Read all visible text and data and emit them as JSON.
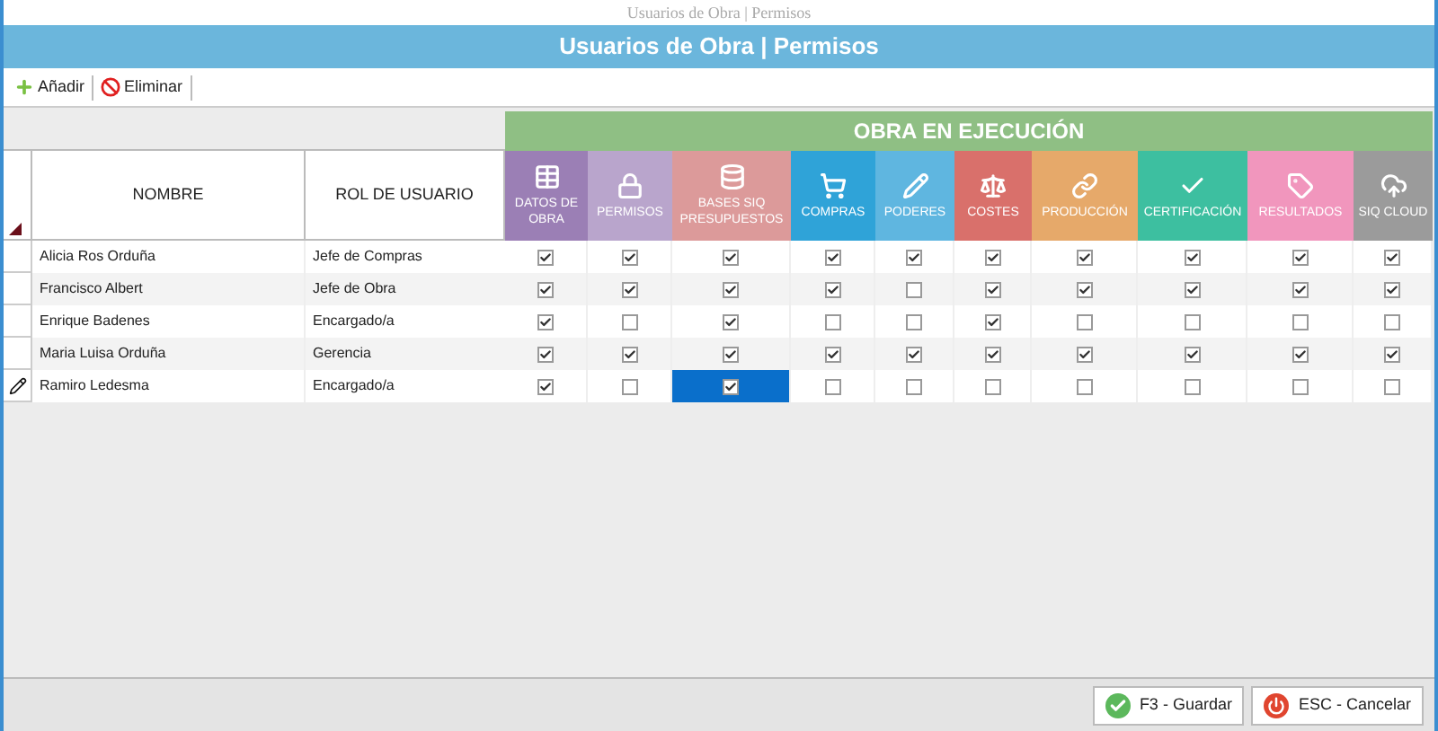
{
  "window": {
    "title": "Usuarios de Obra | Permisos"
  },
  "header": {
    "title": "Usuarios de Obra | Permisos"
  },
  "toolbar": [
    {
      "label": "Añadir",
      "kind": "add"
    },
    {
      "label": "Eliminar",
      "kind": "delete"
    }
  ],
  "table": {
    "group_header": "OBRA EN EJECUCIÓN",
    "name_column": "NOMBRE",
    "role_column": "ROL DE USUARIO",
    "columns": [
      {
        "label": "DATOS DE OBRA",
        "kind": "grid",
        "color": "#9b7fb5"
      },
      {
        "label": "PERMISOS",
        "kind": "lock",
        "color": "#b9a5cc"
      },
      {
        "label": "BASES SIQ PRESUPUESTOS",
        "kind": "database",
        "color": "#dc9a9a"
      },
      {
        "label": "COMPRAS",
        "kind": "cart",
        "color": "#2fa3d8"
      },
      {
        "label": "PODERES",
        "kind": "pencil",
        "color": "#5fb6e0"
      },
      {
        "label": "COSTES",
        "kind": "scale",
        "color": "#d9706b"
      },
      {
        "label": "PRODUCCIÓN",
        "kind": "link",
        "color": "#e6a96a"
      },
      {
        "label": "CERTIFICACIÓN",
        "kind": "check",
        "color": "#3dbfa0"
      },
      {
        "label": "RESULTADOS",
        "kind": "tag",
        "color": "#f196bd"
      },
      {
        "label": "SIQ CLOUD",
        "kind": "cloud",
        "color": "#9b9b9b"
      }
    ],
    "rows": [
      {
        "name": "Alicia Ros Orduña",
        "role": "Jefe de Compras",
        "editing": false,
        "permissions": [
          {
            "checked": true,
            "selected": false
          },
          {
            "checked": true,
            "selected": false
          },
          {
            "checked": true,
            "selected": false
          },
          {
            "checked": true,
            "selected": false
          },
          {
            "checked": true,
            "selected": false
          },
          {
            "checked": true,
            "selected": false
          },
          {
            "checked": true,
            "selected": false
          },
          {
            "checked": true,
            "selected": false
          },
          {
            "checked": true,
            "selected": false
          },
          {
            "checked": true,
            "selected": false
          }
        ]
      },
      {
        "name": "Francisco Albert",
        "role": "Jefe de Obra",
        "editing": false,
        "permissions": [
          {
            "checked": true,
            "selected": false
          },
          {
            "checked": true,
            "selected": false
          },
          {
            "checked": true,
            "selected": false
          },
          {
            "checked": true,
            "selected": false
          },
          {
            "checked": false,
            "selected": false
          },
          {
            "checked": true,
            "selected": false
          },
          {
            "checked": true,
            "selected": false
          },
          {
            "checked": true,
            "selected": false
          },
          {
            "checked": true,
            "selected": false
          },
          {
            "checked": true,
            "selected": false
          }
        ]
      },
      {
        "name": "Enrique Badenes",
        "role": "Encargado/a",
        "editing": false,
        "permissions": [
          {
            "checked": true,
            "selected": false
          },
          {
            "checked": false,
            "selected": false
          },
          {
            "checked": true,
            "selected": false
          },
          {
            "checked": false,
            "selected": false
          },
          {
            "checked": false,
            "selected": false
          },
          {
            "checked": true,
            "selected": false
          },
          {
            "checked": false,
            "selected": false
          },
          {
            "checked": false,
            "selected": false
          },
          {
            "checked": false,
            "selected": false
          },
          {
            "checked": false,
            "selected": false
          }
        ]
      },
      {
        "name": "Maria Luisa Orduña",
        "role": "Gerencia",
        "editing": false,
        "permissions": [
          {
            "checked": true,
            "selected": false
          },
          {
            "checked": true,
            "selected": false
          },
          {
            "checked": true,
            "selected": false
          },
          {
            "checked": true,
            "selected": false
          },
          {
            "checked": true,
            "selected": false
          },
          {
            "checked": true,
            "selected": false
          },
          {
            "checked": true,
            "selected": false
          },
          {
            "checked": true,
            "selected": false
          },
          {
            "checked": true,
            "selected": false
          },
          {
            "checked": true,
            "selected": false
          }
        ]
      },
      {
        "name": "Ramiro Ledesma",
        "role": "Encargado/a",
        "editing": true,
        "permissions": [
          {
            "checked": true,
            "selected": false
          },
          {
            "checked": false,
            "selected": false
          },
          {
            "checked": true,
            "selected": true
          },
          {
            "checked": false,
            "selected": false
          },
          {
            "checked": false,
            "selected": false
          },
          {
            "checked": false,
            "selected": false
          },
          {
            "checked": false,
            "selected": false
          },
          {
            "checked": false,
            "selected": false
          },
          {
            "checked": false,
            "selected": false
          },
          {
            "checked": false,
            "selected": false
          }
        ]
      }
    ]
  },
  "footer": [
    {
      "label": "F3 - Guardar",
      "kind": "save"
    },
    {
      "label": "ESC - Cancelar",
      "kind": "cancel"
    }
  ]
}
